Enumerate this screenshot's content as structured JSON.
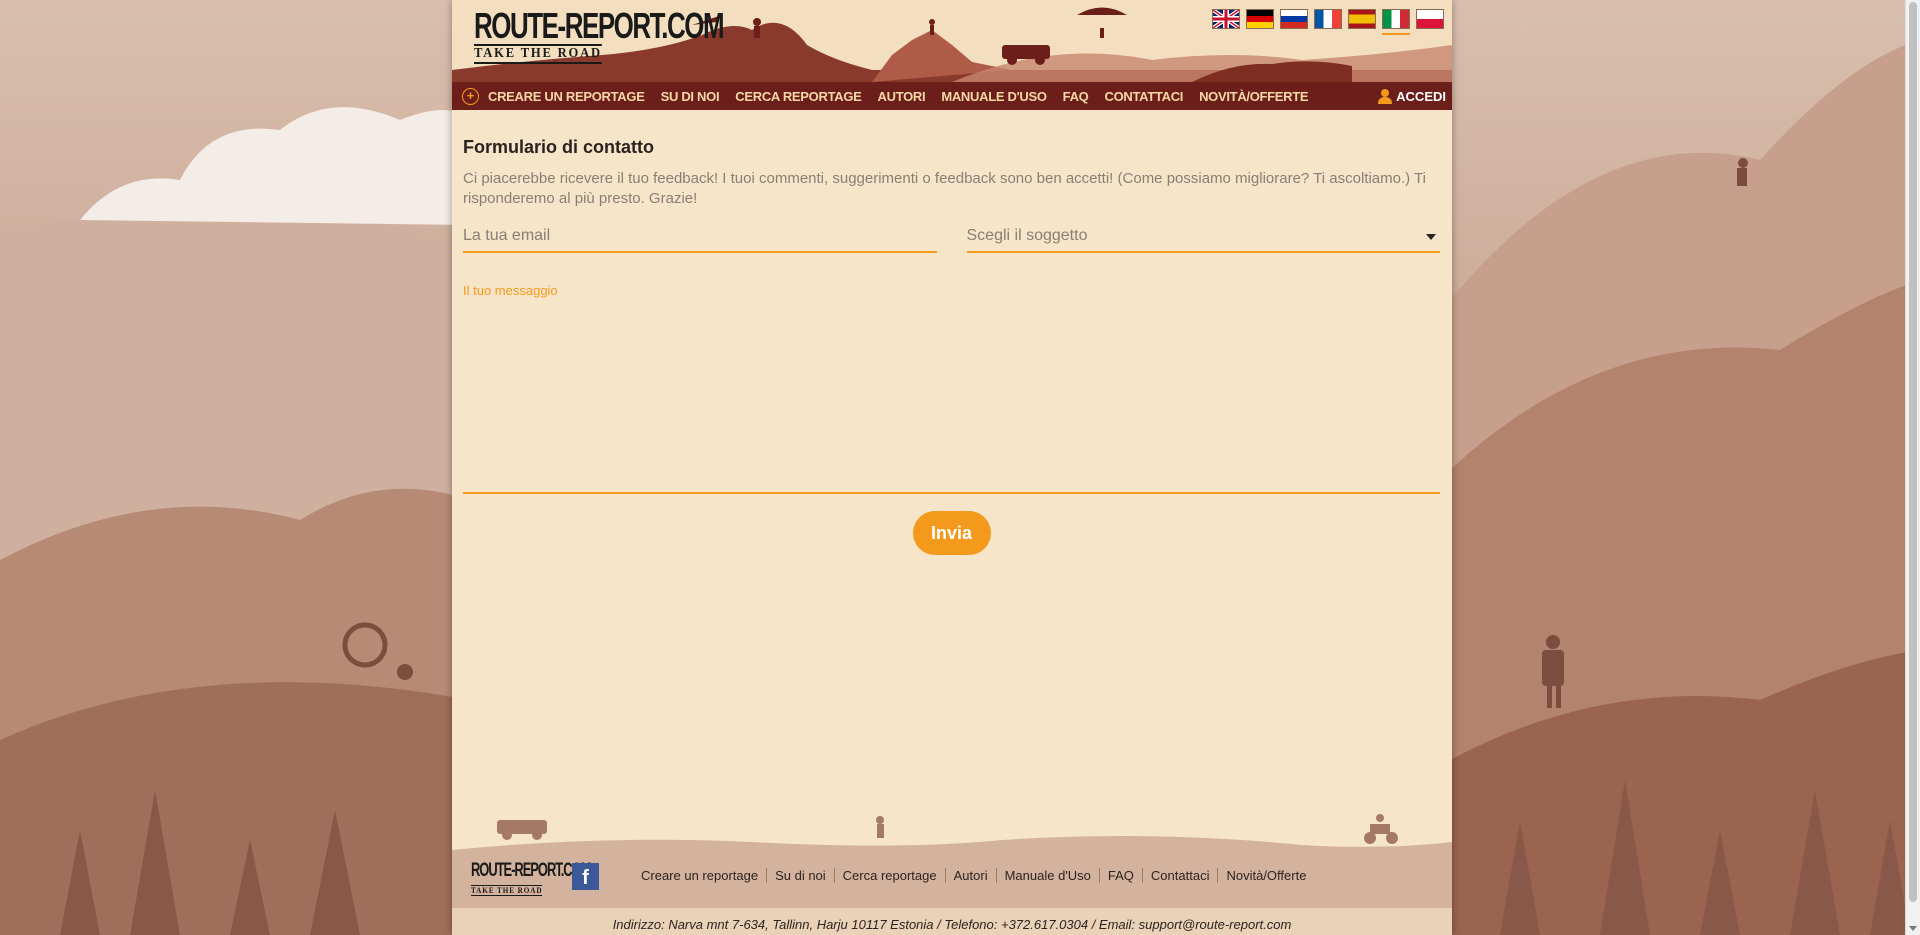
{
  "header": {
    "logo_line1": "ROUTE-REPORT.COM",
    "logo_line2": "TAKE THE ROAD",
    "languages": [
      {
        "code": "en",
        "icon": "uk-flag-icon"
      },
      {
        "code": "de",
        "icon": "germany-flag-icon"
      },
      {
        "code": "ru",
        "icon": "russia-flag-icon"
      },
      {
        "code": "fr",
        "icon": "france-flag-icon"
      },
      {
        "code": "es",
        "icon": "spain-flag-icon"
      },
      {
        "code": "it",
        "icon": "italy-flag-icon",
        "active": true
      },
      {
        "code": "pl",
        "icon": "poland-flag-icon"
      }
    ]
  },
  "nav": {
    "plus_symbol": "+",
    "items": [
      "CREARE UN REPORTAGE",
      "SU DI NOI",
      "CERCA REPORTAGE",
      "AUTORI",
      "MANUALE D'USO",
      "FAQ",
      "CONTATTACI",
      "NOVITÀ/OFFERTE"
    ],
    "login": "ACCEDI"
  },
  "form": {
    "title": "Formulario di contatto",
    "intro": "Ci piacerebbe ricevere il tuo feedback! I tuoi commenti, suggerimenti o feedback sono ben accetti! (Come possiamo migliorare? Ti ascoltiamo.) Ti risponderemo al più presto. Grazie!",
    "email_placeholder": "La tua email",
    "subject_placeholder": "Scegli il soggetto",
    "message_label": "Il tuo messaggio",
    "send": "Invia"
  },
  "footer": {
    "logo_line1": "ROUTE-REPORT.COM",
    "logo_line2": "TAKE THE ROAD",
    "facebook": "f",
    "links": [
      "Creare un reportage",
      "Su di noi",
      "Cerca reportage",
      "Autori",
      "Manuale d'Uso",
      "FAQ",
      "Contattaci",
      "Novità/Offerte"
    ],
    "address": "Indirizzo: Narva mnt 7-634, Tallinn, Harju 10117 Estonia / Telefono: +372.617.0304 / Email: support@route-report.com"
  },
  "colors": {
    "accent": "#f39a1c",
    "nav_bg": "#6b1e1a",
    "page_bg": "#f6e5c9"
  }
}
